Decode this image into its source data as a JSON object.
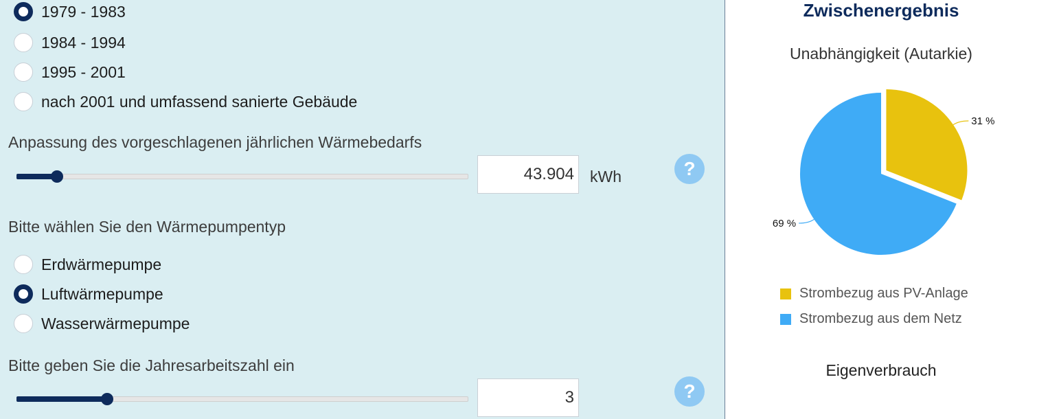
{
  "construction_year": {
    "options": [
      {
        "label": "1979 - 1983",
        "checked": true
      },
      {
        "label": "1984 - 1994",
        "checked": false
      },
      {
        "label": "1995 - 2001",
        "checked": false
      },
      {
        "label": "nach 2001 und umfassend sanierte Gebäude",
        "checked": false
      }
    ]
  },
  "heat_demand": {
    "label": "Anpassung des vorgeschlagenen jährlichen Wärmebedarfs",
    "value": "43.904",
    "unit": "kWh",
    "slider_fraction": 0.09,
    "help": "?"
  },
  "heatpump_type": {
    "label": "Bitte wählen Sie den Wärmepumpentyp",
    "options": [
      {
        "label": "Erdwärmepumpe",
        "checked": false
      },
      {
        "label": "Luftwärmepumpe",
        "checked": true
      },
      {
        "label": "Wasserwärmepumpe",
        "checked": false
      }
    ]
  },
  "jaz": {
    "label": "Bitte geben Sie die Jahresarbeitszahl ein",
    "value": "3",
    "slider_fraction": 0.2,
    "help": "?"
  },
  "result": {
    "title": "Zwischenergebnis",
    "subtitle": "Unabhängigkeit (Autarkie)",
    "footer": "Eigenverbrauch"
  },
  "chart_data": {
    "type": "pie",
    "title": "Unabhängigkeit (Autarkie)",
    "slices": [
      {
        "name": "Strombezug aus PV-Anlage",
        "value": 31,
        "label": "31 %",
        "color": "#e8c20e"
      },
      {
        "name": "Strombezug aus dem Netz",
        "value": 69,
        "label": "69 %",
        "color": "#3fabf6"
      }
    ],
    "legend": "bottom"
  }
}
